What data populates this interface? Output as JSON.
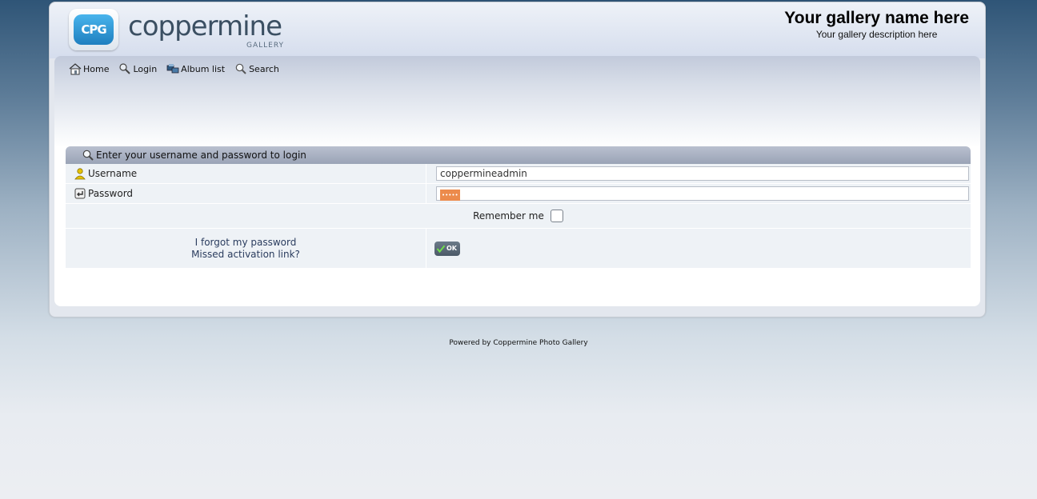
{
  "header": {
    "logo_badge": "CPG",
    "logo_word": "coppermine",
    "logo_sub": "GALLERY",
    "gallery_name": "Your gallery name here",
    "gallery_description": "Your gallery description here"
  },
  "nav": {
    "items": [
      {
        "label": "Home",
        "icon": "home-icon"
      },
      {
        "label": "Login",
        "icon": "login-key-icon"
      },
      {
        "label": "Album list",
        "icon": "album-list-icon"
      },
      {
        "label": "Search",
        "icon": "search-icon"
      }
    ]
  },
  "login": {
    "heading": "Enter your username and password to login",
    "username_label": "Username",
    "username_value": "coppermineadmin",
    "password_label": "Password",
    "password_mask": "•••••",
    "remember_label": "Remember me",
    "remember_checked": false,
    "forgot_password": "I forgot my password",
    "missed_activation": "Missed activation link?",
    "ok_label": "OK"
  },
  "footer": {
    "powered_by": "Powered by",
    "product": "Coppermine Photo Gallery"
  },
  "colors": {
    "accent": "#2a3c5e",
    "header_bar": "#9aa3b6",
    "password_fill": "#ec8b4c"
  }
}
